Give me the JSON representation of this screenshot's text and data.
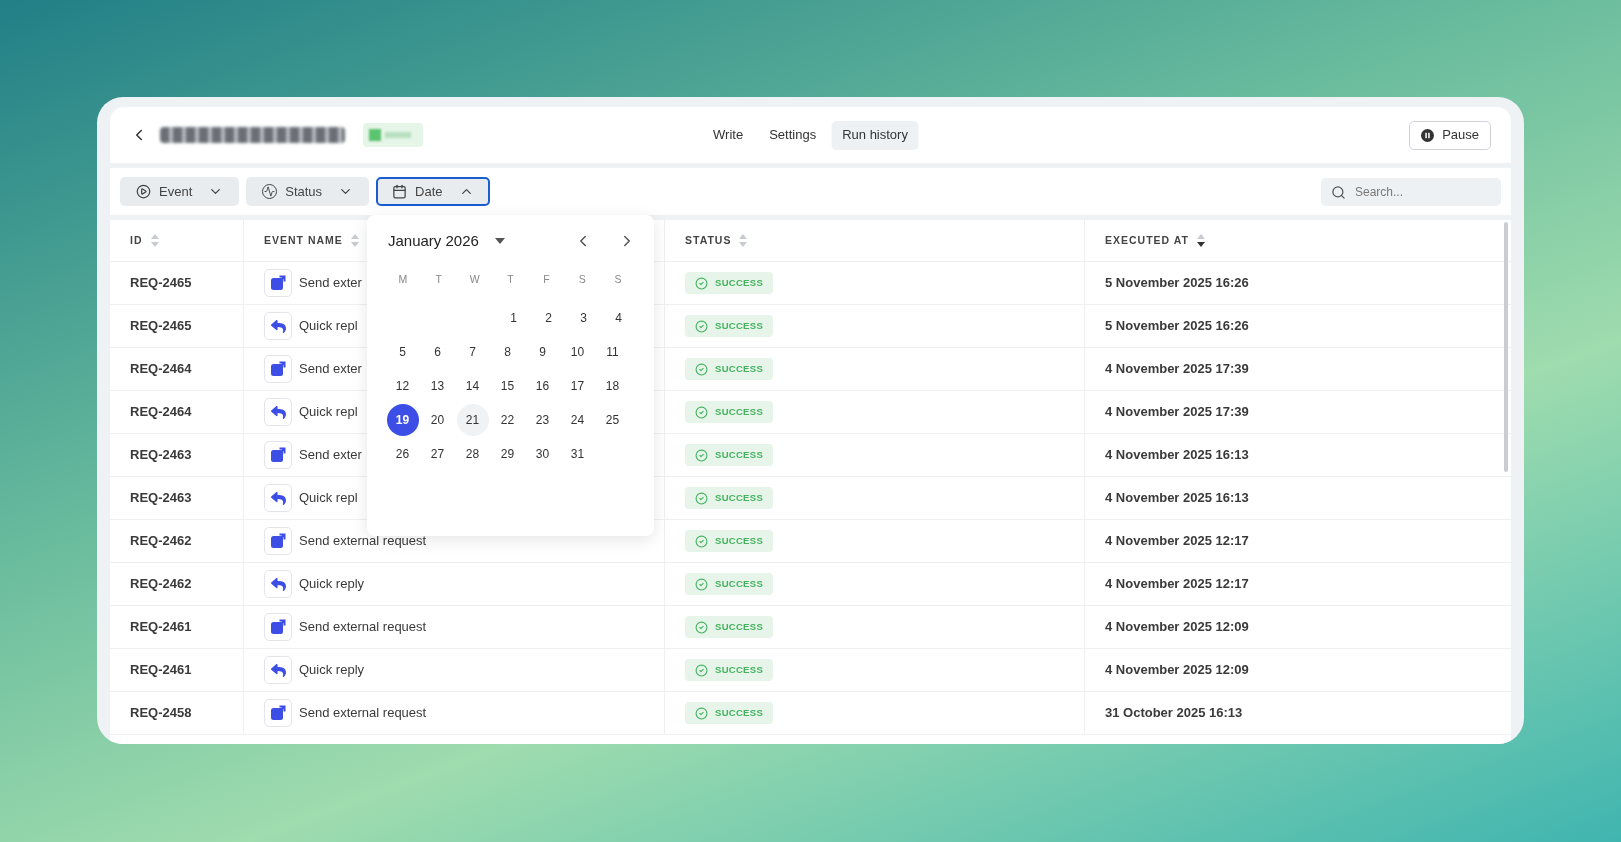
{
  "tabs": [
    {
      "label": "Write",
      "selected": false
    },
    {
      "label": "Settings",
      "selected": false
    },
    {
      "label": "Run history",
      "selected": true
    }
  ],
  "pause_button": {
    "label": "Pause"
  },
  "filters": [
    {
      "label": "Event",
      "kind": "event",
      "open": false
    },
    {
      "label": "Status",
      "kind": "status",
      "open": false
    },
    {
      "label": "Date",
      "kind": "date",
      "open": true
    }
  ],
  "search": {
    "placeholder": "Search..."
  },
  "table": {
    "columns": [
      {
        "label": "ID",
        "sorted": false
      },
      {
        "label": "EVENT NAME",
        "sorted": false
      },
      {
        "label": "STATUS",
        "sorted": false
      },
      {
        "label": "EXECUTED AT",
        "sorted": true
      }
    ],
    "rows": [
      {
        "id": "REQ-2465",
        "kind": "send",
        "event": "Send exter",
        "status": "SUCCESS",
        "executed_at": "5 November 2025 16:26"
      },
      {
        "id": "REQ-2465",
        "kind": "reply",
        "event": "Quick repl",
        "status": "SUCCESS",
        "executed_at": "5 November 2025 16:26"
      },
      {
        "id": "REQ-2464",
        "kind": "send",
        "event": "Send exter",
        "status": "SUCCESS",
        "executed_at": "4 November 2025 17:39"
      },
      {
        "id": "REQ-2464",
        "kind": "reply",
        "event": "Quick repl",
        "status": "SUCCESS",
        "executed_at": "4 November 2025 17:39"
      },
      {
        "id": "REQ-2463",
        "kind": "send",
        "event": "Send exter",
        "status": "SUCCESS",
        "executed_at": "4 November 2025 16:13"
      },
      {
        "id": "REQ-2463",
        "kind": "reply",
        "event": "Quick repl",
        "status": "SUCCESS",
        "executed_at": "4 November 2025 16:13"
      },
      {
        "id": "REQ-2462",
        "kind": "send",
        "event": "Send external request",
        "status": "SUCCESS",
        "executed_at": "4 November 2025 12:17"
      },
      {
        "id": "REQ-2462",
        "kind": "reply",
        "event": "Quick reply",
        "status": "SUCCESS",
        "executed_at": "4 November 2025 12:17"
      },
      {
        "id": "REQ-2461",
        "kind": "send",
        "event": "Send external request",
        "status": "SUCCESS",
        "executed_at": "4 November 2025 12:09"
      },
      {
        "id": "REQ-2461",
        "kind": "reply",
        "event": "Quick reply",
        "status": "SUCCESS",
        "executed_at": "4 November 2025 12:09"
      },
      {
        "id": "REQ-2458",
        "kind": "send",
        "event": "Send external request",
        "status": "SUCCESS",
        "executed_at": "31 October 2025 16:13"
      }
    ]
  },
  "calendar": {
    "month": "January 2026",
    "weekdays": [
      "M",
      "T",
      "W",
      "T",
      "F",
      "S",
      "S"
    ],
    "weeks": [
      [
        {
          "label": "1",
          "selected": false,
          "today": false
        },
        {
          "label": "2",
          "selected": false,
          "today": false
        },
        {
          "label": "3",
          "selected": false,
          "today": false
        },
        {
          "label": "4",
          "selected": false,
          "today": false
        }
      ],
      [
        {
          "label": "5",
          "selected": false,
          "today": false
        },
        {
          "label": "6",
          "selected": false,
          "today": false
        },
        {
          "label": "7",
          "selected": false,
          "today": false
        },
        {
          "label": "8",
          "selected": false,
          "today": false
        },
        {
          "label": "9",
          "selected": false,
          "today": false
        },
        {
          "label": "10",
          "selected": false,
          "today": false
        },
        {
          "label": "11",
          "selected": false,
          "today": false
        }
      ],
      [
        {
          "label": "12",
          "selected": false,
          "today": false
        },
        {
          "label": "13",
          "selected": false,
          "today": false
        },
        {
          "label": "14",
          "selected": false,
          "today": false
        },
        {
          "label": "15",
          "selected": false,
          "today": false
        },
        {
          "label": "16",
          "selected": false,
          "today": false
        },
        {
          "label": "17",
          "selected": false,
          "today": false
        },
        {
          "label": "18",
          "selected": false,
          "today": false
        }
      ],
      [
        {
          "label": "19",
          "selected": true,
          "today": false
        },
        {
          "label": "20",
          "selected": false,
          "today": false
        },
        {
          "label": "21",
          "selected": false,
          "today": true
        },
        {
          "label": "22",
          "selected": false,
          "today": false
        },
        {
          "label": "23",
          "selected": false,
          "today": false
        },
        {
          "label": "24",
          "selected": false,
          "today": false
        },
        {
          "label": "25",
          "selected": false,
          "today": false
        }
      ],
      [
        {
          "label": "26",
          "selected": false,
          "today": false
        },
        {
          "label": "27",
          "selected": false,
          "today": false
        },
        {
          "label": "28",
          "selected": false,
          "today": false
        },
        {
          "label": "29",
          "selected": false,
          "today": false
        },
        {
          "label": "30",
          "selected": false,
          "today": false
        },
        {
          "label": "31",
          "selected": false,
          "today": false
        }
      ]
    ]
  }
}
